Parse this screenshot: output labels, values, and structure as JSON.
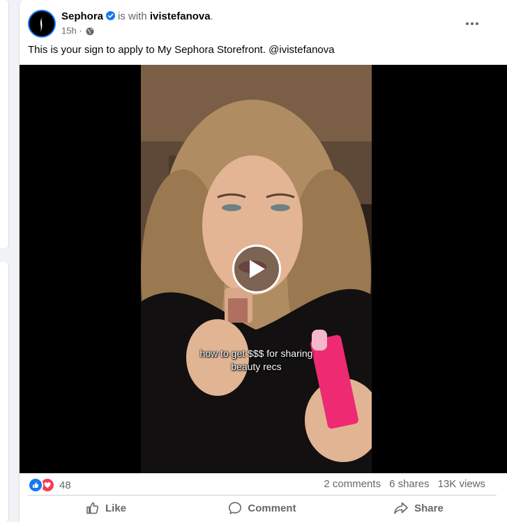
{
  "post": {
    "author": "Sephora",
    "with_text": "is with",
    "tagged_user": "ivistefanova",
    "tagged_suffix": ".",
    "time": "15h",
    "time_separator": "·",
    "text": "This is your sign to apply to My Sephora Storefront. @ivistefanova"
  },
  "video": {
    "caption_line1": "how to get $$$ for sharing",
    "caption_line2": "beauty recs"
  },
  "stats": {
    "reaction_count": "48",
    "comments": "2 comments",
    "shares": "6 shares",
    "views": "13K views"
  },
  "actions": {
    "like": "Like",
    "comment": "Comment",
    "share": "Share"
  },
  "colors": {
    "brand_blue": "#1877f2",
    "love_red": "#f33e58",
    "secondary_text": "#65676b"
  },
  "icons": {
    "verified": "verified-badge-icon",
    "privacy": "globe-icon",
    "more": "more-options-icon",
    "play": "play-icon",
    "like_reaction": "thumbs-up-reaction-icon",
    "love_reaction": "heart-reaction-icon",
    "like_action": "thumbs-up-outline-icon",
    "comment_action": "speech-bubble-icon",
    "share_action": "share-arrow-icon"
  }
}
